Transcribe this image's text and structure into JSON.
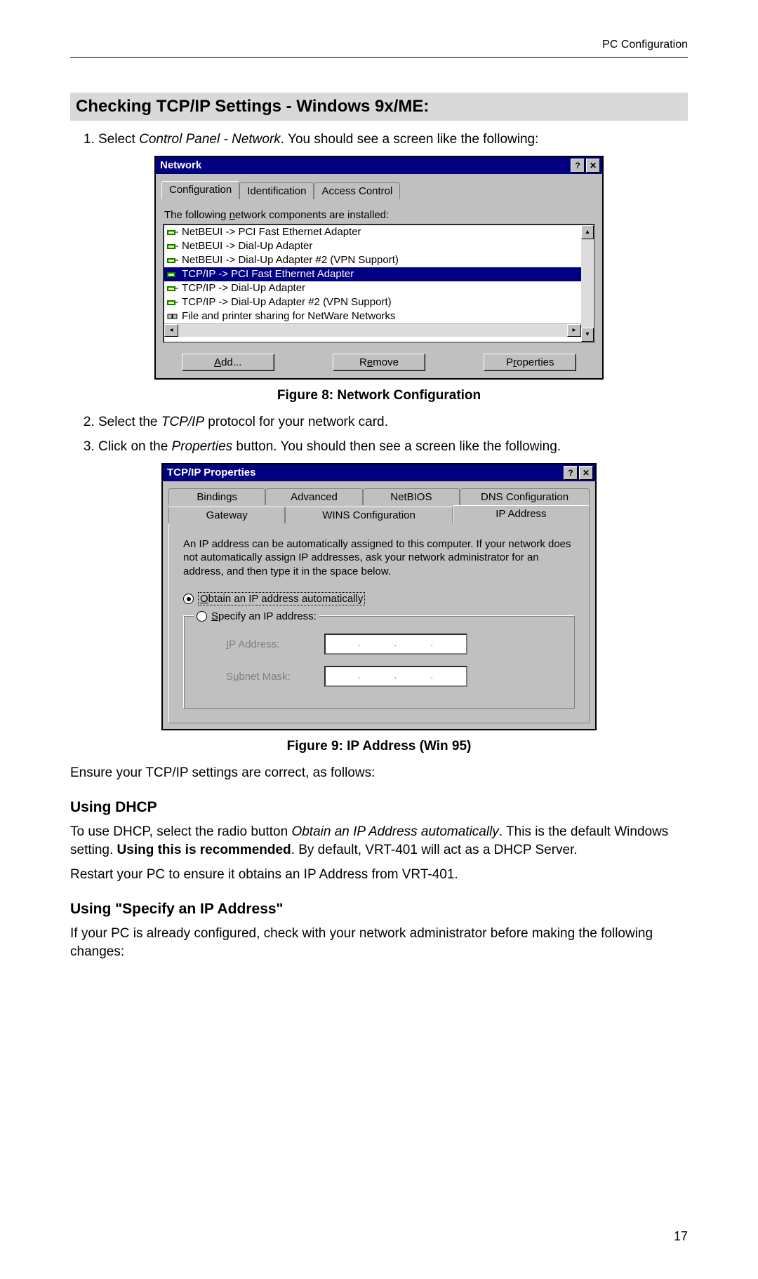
{
  "header": {
    "right": "PC Configuration"
  },
  "section_title": "Checking TCP/IP Settings - Windows 9x/ME:",
  "step1": {
    "num": "1.",
    "pre": "Select ",
    "italic": "Control Panel - Network",
    "post": ". You should see a screen like the following:"
  },
  "network_dialog": {
    "title": "Network",
    "tabs": [
      "Configuration",
      "Identification",
      "Access Control"
    ],
    "label_installed_pre": "The following ",
    "label_installed_u": "n",
    "label_installed_post": "etwork components are installed:",
    "items": [
      {
        "text": "NetBEUI -> PCI Fast Ethernet Adapter",
        "icon": "adapter"
      },
      {
        "text": "NetBEUI -> Dial-Up Adapter",
        "icon": "adapter"
      },
      {
        "text": "NetBEUI -> Dial-Up Adapter #2 (VPN Support)",
        "icon": "adapter"
      },
      {
        "text": "TCP/IP -> PCI Fast Ethernet Adapter",
        "icon": "adapter",
        "selected": true
      },
      {
        "text": "TCP/IP -> Dial-Up Adapter",
        "icon": "adapter"
      },
      {
        "text": "TCP/IP -> Dial-Up Adapter #2 (VPN Support)",
        "icon": "adapter"
      },
      {
        "text": "File and printer sharing for NetWare Networks",
        "icon": "service"
      }
    ],
    "btn_add_u": "A",
    "btn_add_post": "dd...",
    "btn_remove_pre": "R",
    "btn_remove_u": "e",
    "btn_remove_post": "move",
    "btn_props_pre": "P",
    "btn_props_u": "r",
    "btn_props_post": "operties"
  },
  "fig8_caption": "Figure 8: Network Configuration",
  "step2": {
    "num": "2.",
    "pre": "Select the ",
    "italic": "TCP/IP",
    "post": " protocol for your network card."
  },
  "step3": {
    "num": "3.",
    "pre": "Click on the ",
    "italic": "Properties",
    "post": " button. You should then see a screen like the following."
  },
  "tcpip_dialog": {
    "title": "TCP/IP Properties",
    "tabs_back": [
      "Bindings",
      "Advanced",
      "NetBIOS",
      "DNS Configuration"
    ],
    "tabs_front_left": "Gateway",
    "tabs_front_mid": "WINS Configuration",
    "tabs_front_right": "IP Address",
    "desc": "An IP address can be automatically assigned to this computer. If your network does not automatically assign IP addresses, ask your network administrator for an address, and then type it in the space below.",
    "radio_auto_u": "O",
    "radio_auto_post": "btain an IP address automatically",
    "radio_spec_u": "S",
    "radio_spec_post": "pecify an IP address:",
    "lbl_ip_u": "I",
    "lbl_ip_post": "P Address:",
    "lbl_mask_pre": "S",
    "lbl_mask_u": "u",
    "lbl_mask_post": "bnet Mask:"
  },
  "fig9_caption": "Figure 9: IP Address (Win 95)",
  "ensure_text": "Ensure your TCP/IP settings are correct, as follows:",
  "dhcp_head": "Using DHCP",
  "dhcp_p1_pre": "To use DHCP, select the radio button ",
  "dhcp_p1_italic": "Obtain an IP Address automatically",
  "dhcp_p1_mid": ". This is the default Windows setting. ",
  "dhcp_p1_bold": "Using this is recommended",
  "dhcp_p1_post": ". By default, VRT-401 will act as a DHCP Server.",
  "dhcp_p2": "Restart your PC to ensure it obtains an IP Address from VRT-401.",
  "spec_head": "Using \"Specify an IP Address\"",
  "spec_p1": "If your PC is already configured, check with your network administrator before making the following changes:",
  "page_number": "17"
}
